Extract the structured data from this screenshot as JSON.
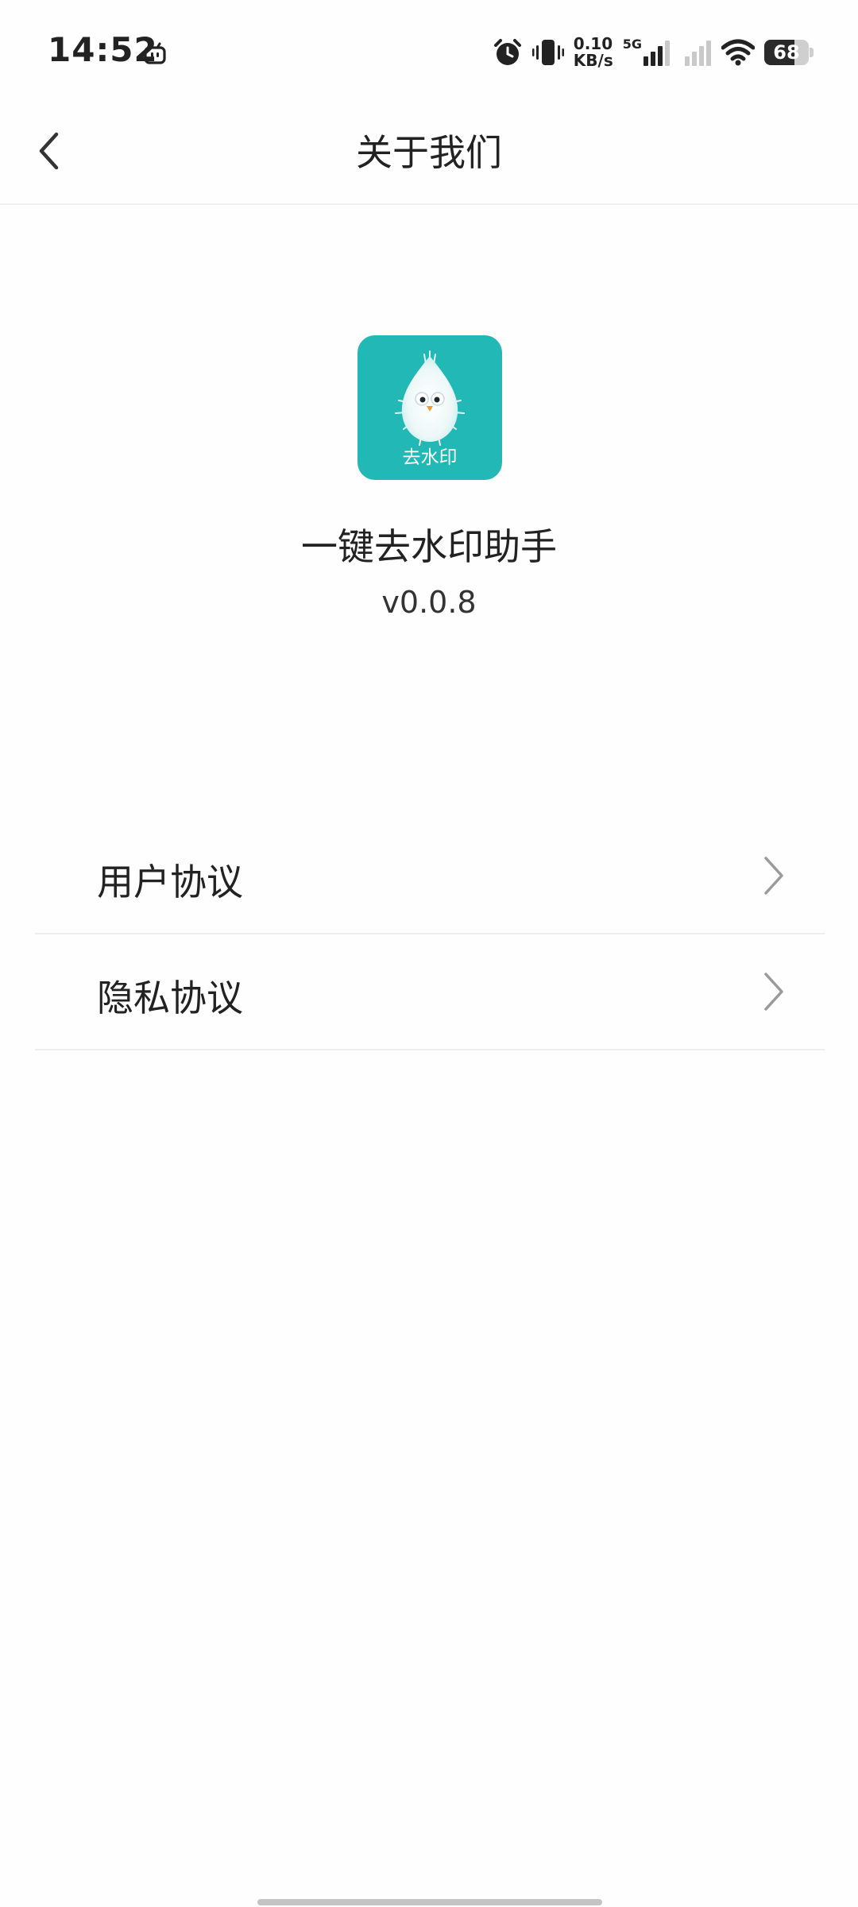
{
  "status_bar": {
    "time": "14:52",
    "net_speed_value": "0.10",
    "net_speed_unit": "KB/s",
    "network_gen": "5G",
    "battery_level": "68",
    "battery_fraction": 0.68,
    "icons": [
      "tv-icon",
      "alarm-icon",
      "vibrate-icon",
      "signal-bars-icon",
      "wifi-icon",
      "battery-icon"
    ]
  },
  "header": {
    "back_icon": "chevron-left-icon",
    "title": "关于我们"
  },
  "app_info": {
    "logo_text": "去水印",
    "name": "一键去水印助手",
    "version": "v0.0.8"
  },
  "menu": {
    "items": [
      {
        "label": "用户协议",
        "icon": "chevron-right-icon"
      },
      {
        "label": "隐私协议",
        "icon": "chevron-right-icon"
      }
    ]
  },
  "colors": {
    "logo_background": "#22b8b6",
    "text_primary": "#222222",
    "divider": "#eeeeee",
    "chevron": "#9a9a9a"
  }
}
